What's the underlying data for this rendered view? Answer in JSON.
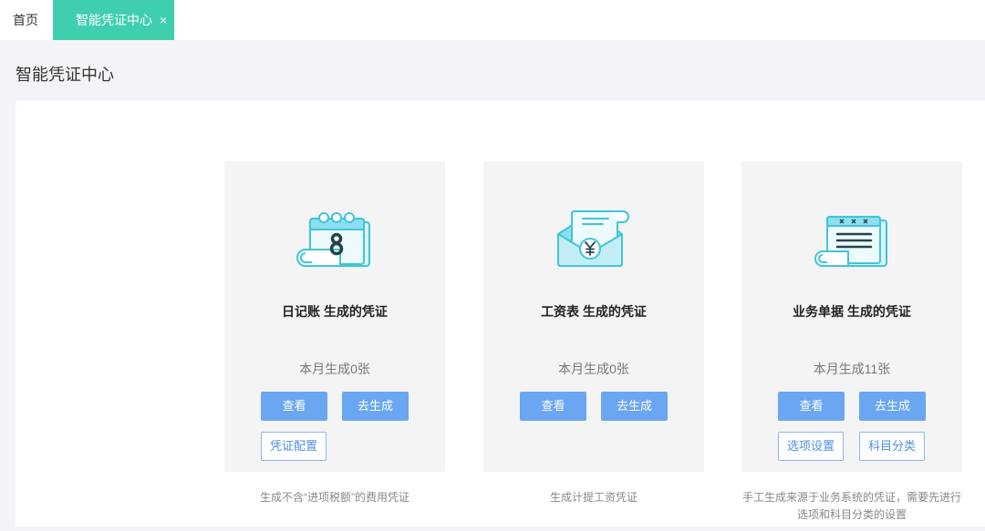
{
  "tabs": {
    "home": {
      "label": "首页"
    },
    "active": {
      "label": "智能凭证中心",
      "close_glyph": "×",
      "close_icon": "close-icon"
    }
  },
  "page_title": "智能凭证中心",
  "colors": {
    "page_background": "#f3f4f7",
    "active_tab": "#40cfae",
    "card_background": "#f4f4f4",
    "primary_button": "#6aa6f1",
    "outline_button_text": "#4f8fe2",
    "icon_stroke": "#3ec5db"
  },
  "cards": [
    {
      "icon": "calendar-icon",
      "title": "日记账 生成的凭证",
      "count_text": "本月生成0张",
      "primary_buttons": [
        "查看",
        "去生成"
      ],
      "secondary_buttons": [
        "凭证配置"
      ],
      "description": [
        "生成不含“进项税额”的费用凭证"
      ]
    },
    {
      "icon": "salary-envelope-icon",
      "title": "工资表 生成的凭证",
      "count_text": "本月生成0张",
      "primary_buttons": [
        "查看",
        "去生成"
      ],
      "secondary_buttons": [],
      "description": [
        "生成计提工资凭证"
      ]
    },
    {
      "icon": "document-list-icon",
      "title": "业务单据 生成的凭证",
      "count_text": "本月生成11张",
      "primary_buttons": [
        "查看",
        "去生成"
      ],
      "secondary_buttons": [
        "选项设置",
        "科目分类"
      ],
      "description": [
        "手工生成来源于业务系统的凭证，需要先进行",
        "选项和科目分类的设置"
      ]
    }
  ]
}
